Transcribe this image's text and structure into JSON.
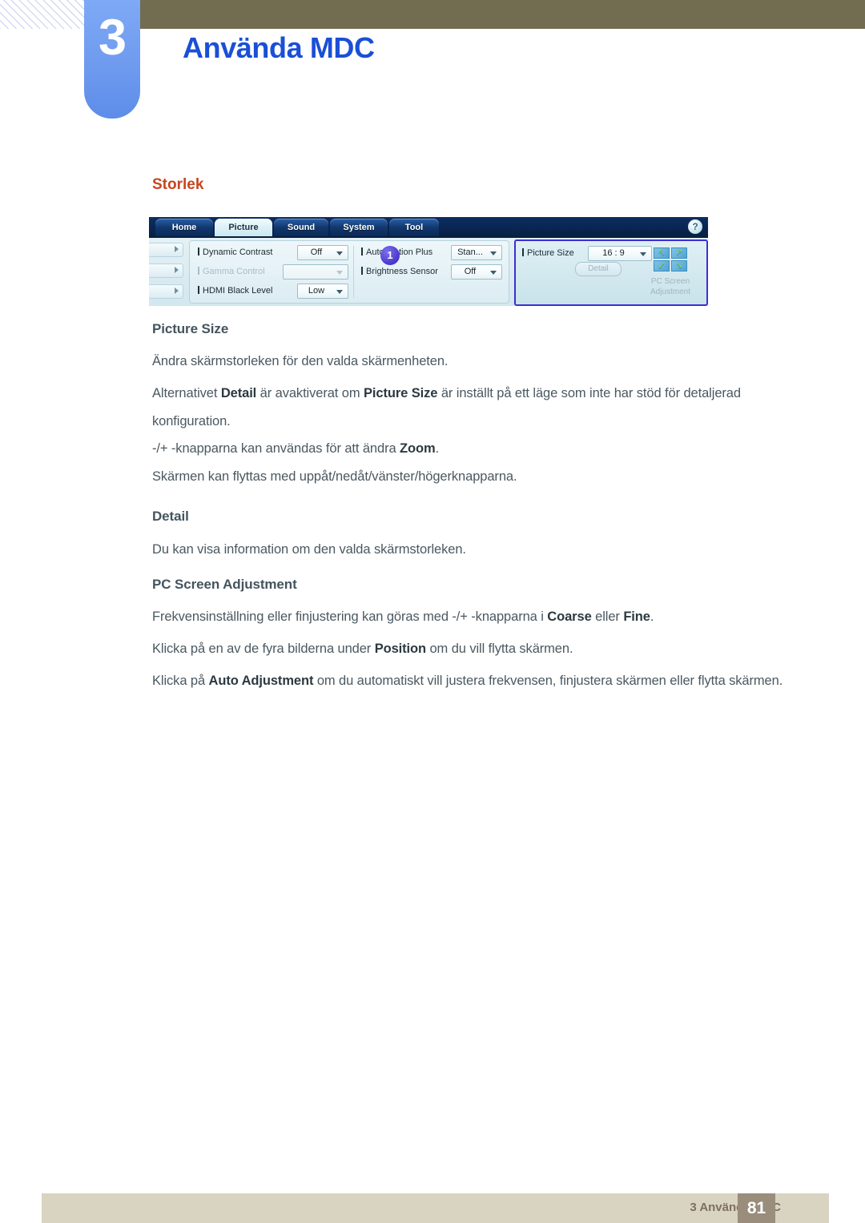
{
  "header": {
    "chapter_number": "3",
    "chapter_title": "Använda MDC",
    "accent_blue": "#1a4fd6",
    "tab_blue": "#6f9bef",
    "olive": "#726c51"
  },
  "section": {
    "heading": "Storlek",
    "heading_color": "#c5461e"
  },
  "mdc_screenshot": {
    "tabs": [
      {
        "label": "Home",
        "active": false
      },
      {
        "label": "Picture",
        "active": true
      },
      {
        "label": "Sound",
        "active": false
      },
      {
        "label": "System",
        "active": false
      },
      {
        "label": "Tool",
        "active": false
      }
    ],
    "help_icon": "?",
    "left_column": [
      {
        "label": "Dynamic Contrast",
        "value": "Off",
        "disabled": false
      },
      {
        "label": "Gamma Control",
        "value": "",
        "disabled": true
      },
      {
        "label": "HDMI Black Level",
        "value": "Low",
        "disabled": false
      }
    ],
    "middle_column": [
      {
        "label": "Auto Motion Plus",
        "value": "Stan...",
        "disabled": false
      },
      {
        "label": "Brightness Sensor",
        "value": "Off",
        "disabled": false
      }
    ],
    "right_panel": {
      "picture_size_label": "Picture Size",
      "picture_size_value": "16 : 9",
      "detail_button": "Detail",
      "pc_screen_adjustment_label": "PC Screen Adjustment",
      "grid_arrows": [
        "↖",
        "↗",
        "↙",
        "↘"
      ],
      "highlight_color": "#3b2fd4"
    },
    "callout_badge": "1"
  },
  "content": {
    "picture_size_heading": "Picture Size",
    "picture_size_p1": "Ändra skärmstorleken för den valda skärmenheten.",
    "picture_size_p2_a": "Alternativet ",
    "picture_size_p2_b1": "Detail",
    "picture_size_p2_c": " är avaktiverat om ",
    "picture_size_p2_b2": "Picture Size",
    "picture_size_p2_d": " är inställt på ett läge som inte har stöd för detaljerad konfiguration.",
    "picture_size_p3_a": "-/+ -knapparna kan användas för att ändra ",
    "picture_size_p3_b": "Zoom",
    "picture_size_p3_c": ".",
    "picture_size_p4": "Skärmen kan flyttas med uppåt/nedåt/vänster/högerknapparna.",
    "detail_heading": "Detail",
    "detail_p1": "Du kan visa information om den valda skärmstorleken.",
    "pcsa_heading": "PC Screen Adjustment",
    "pcsa_p1_a": "Frekvensinställning eller finjustering kan göras med -/+ -knapparna i ",
    "pcsa_p1_b1": "Coarse",
    "pcsa_p1_c": " eller ",
    "pcsa_p1_b2": "Fine",
    "pcsa_p1_d": ".",
    "pcsa_p2_a": "Klicka på en av de fyra bilderna under ",
    "pcsa_p2_b": "Position",
    "pcsa_p2_c": " om du vill flytta skärmen.",
    "pcsa_p3_a": "Klicka på ",
    "pcsa_p3_b": "Auto Adjustment",
    "pcsa_p3_c": " om du automatiskt vill justera frekvensen, finjustera skärmen eller flytta skärmen."
  },
  "footer": {
    "text": "3 Använda MDC",
    "page_number": "81",
    "bar_color": "#d9d3c2",
    "page_box_color": "#9a8d7c"
  }
}
